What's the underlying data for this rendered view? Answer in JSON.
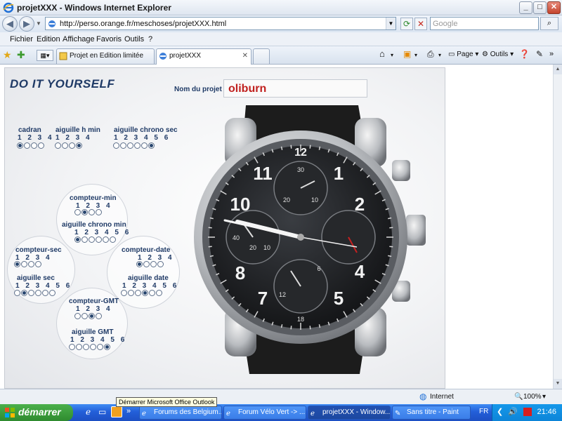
{
  "window": {
    "title": "projetXXX - Windows Internet Explorer"
  },
  "address_bar": {
    "url": "http://perso.orange.fr/meschoses/projetXXX.html",
    "search_placeholder": "Google"
  },
  "menu": [
    "Fichier",
    "Edition",
    "Affichage",
    "Favoris",
    "Outils",
    "?"
  ],
  "tabs": [
    {
      "label": "Projet en Edition limitée",
      "active": false
    },
    {
      "label": "projetXXX",
      "active": true
    }
  ],
  "toolbar": {
    "page_label": "Page",
    "tools_label": "Outils"
  },
  "page": {
    "title": "DO IT YOURSELF",
    "project_label": "Nom du projet :",
    "project_name": "oliburn",
    "groups": {
      "cadran": {
        "label": "cadran",
        "options": "1 2 3 4",
        "selected": 1
      },
      "aiguille_h_min": {
        "label": "aiguille h min",
        "options": "1 2 3 4",
        "selected": 4
      },
      "aiguille_chrono_sec": {
        "label": "aiguille chrono sec",
        "options": "1 2 3 4 5 6",
        "selected": 6
      },
      "compteur_min": {
        "label": "compteur-min",
        "options": "1 2 3 4",
        "selected": 2
      },
      "aiguille_chrono_min": {
        "label": "aiguille chrono min",
        "options": "1 2 3 4 5 6",
        "selected": 1
      },
      "compteur_sec": {
        "label": "compteur-sec",
        "options": "1 2 3 4",
        "selected": 1
      },
      "aiguille_sec": {
        "label": "aiguille sec",
        "options": "1 2 3 4 5 6",
        "selected": 2
      },
      "compteur_date": {
        "label": "compteur-date",
        "options": "1 2 3 4",
        "selected": 1
      },
      "aiguille_date": {
        "label": "aiguille date",
        "options": "1 2 3 4 5 6",
        "selected": 4
      },
      "compteur_gmt": {
        "label": "compteur-GMT",
        "options": "1 2 3 4",
        "selected": 3
      },
      "aiguille_gmt": {
        "label": "aiguille GMT",
        "options": "1 2 3 4 5 6",
        "selected": 6
      }
    }
  },
  "status": {
    "zone": "Internet",
    "zoom": "100%"
  },
  "taskbar": {
    "start_label": "démarrer",
    "tooltip": "Démarrer Microsoft Office Outlook",
    "items": [
      "Forums des Belgium...",
      "Forum Vélo Vert -> ...",
      "projetXXX - Window...",
      "Sans titre - Paint"
    ],
    "lang": "FR",
    "clock": "21:46"
  }
}
